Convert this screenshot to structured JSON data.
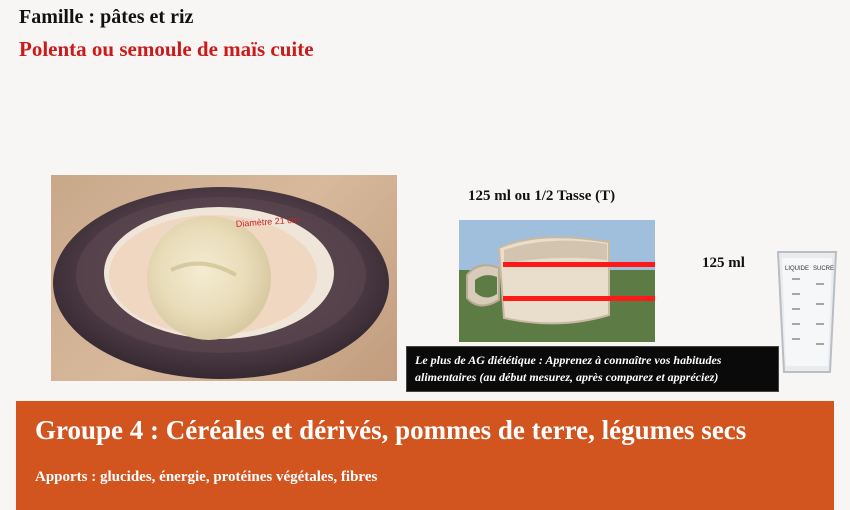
{
  "header": {
    "family": "Famille : pâtes et riz",
    "food": "Polenta ou semoule de maïs cuite"
  },
  "plate": {
    "diameter_text": "Diamètre 21 cm"
  },
  "serving": {
    "label": "125 ml ou 1/2 Tasse (T)",
    "ml_marker": "125 ml"
  },
  "beaker": {
    "liquide_label": "LIQUIDE",
    "sucre_label": "SUCRE"
  },
  "tip": {
    "text": "Le plus de AG diététique : Apprenez à connaître vos habitudes alimentaires (au début mesurez, après comparez et appréciez)"
  },
  "group": {
    "title": "Groupe 4 : Céréales et dérivés, pommes de terre, légumes secs",
    "intake": "Apports : glucides, énergie, protéines végétales, fibres"
  },
  "colors": {
    "food_title": "#cc1a1a",
    "banner": "#d2541f",
    "marker_line": "#ff1a1a"
  }
}
